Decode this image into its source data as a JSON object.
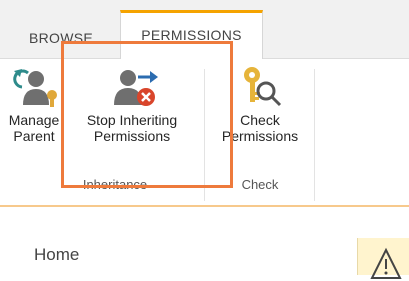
{
  "tabs": [
    {
      "label": "BROWSE"
    },
    {
      "label": "PERMISSIONS"
    }
  ],
  "ribbon": {
    "manage_parent": {
      "line1": "Manage",
      "line2": "Parent"
    },
    "stop_inheriting": {
      "line1": "Stop Inheriting",
      "line2": "Permissions"
    },
    "check_permissions": {
      "line1": "Check",
      "line2": "Permissions"
    },
    "groups": {
      "inheritance": "Inheritance",
      "check": "Check"
    }
  },
  "nav": {
    "home": "Home"
  },
  "colors": {
    "accent_tab": "#f5a300",
    "highlight": "#ee7a3c",
    "warning_bg": "#fff4ce"
  },
  "icons": [
    "manage-parent-icon",
    "stop-inheriting-icon",
    "check-permissions-icon",
    "warning-icon"
  ]
}
